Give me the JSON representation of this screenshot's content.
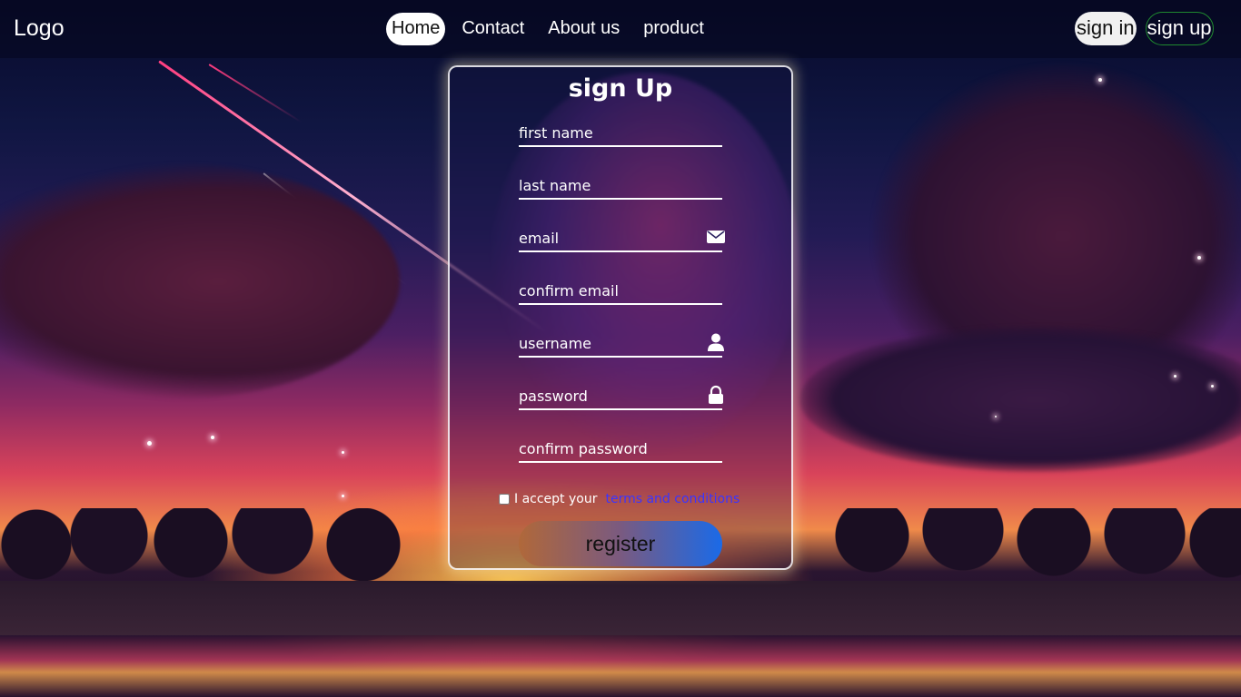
{
  "nav": {
    "logo": "Logo",
    "links": [
      {
        "label": "Home",
        "active": true
      },
      {
        "label": "Contact",
        "active": false
      },
      {
        "label": "About us",
        "active": false
      },
      {
        "label": "product",
        "active": false
      }
    ],
    "sign_in": "sign in",
    "sign_up": "sign up"
  },
  "form": {
    "title": "sign Up",
    "fields": {
      "first_name": {
        "placeholder": "first name"
      },
      "last_name": {
        "placeholder": "last name"
      },
      "email": {
        "placeholder": "email",
        "icon": "envelope-icon"
      },
      "confirm_email": {
        "placeholder": "confirm email"
      },
      "username": {
        "placeholder": "username",
        "icon": "user-icon"
      },
      "password": {
        "placeholder": "password",
        "icon": "lock-icon"
      },
      "confirm_password": {
        "placeholder": "confirm password"
      }
    },
    "terms_prefix": "I accept your",
    "terms_link": "terms and conditions",
    "register_label": "register"
  },
  "colors": {
    "link": "#3a34ff",
    "signup_border": "#1f8a2f",
    "button_gradient_start": "#b0683a",
    "button_gradient_end": "#1a6ae8"
  }
}
